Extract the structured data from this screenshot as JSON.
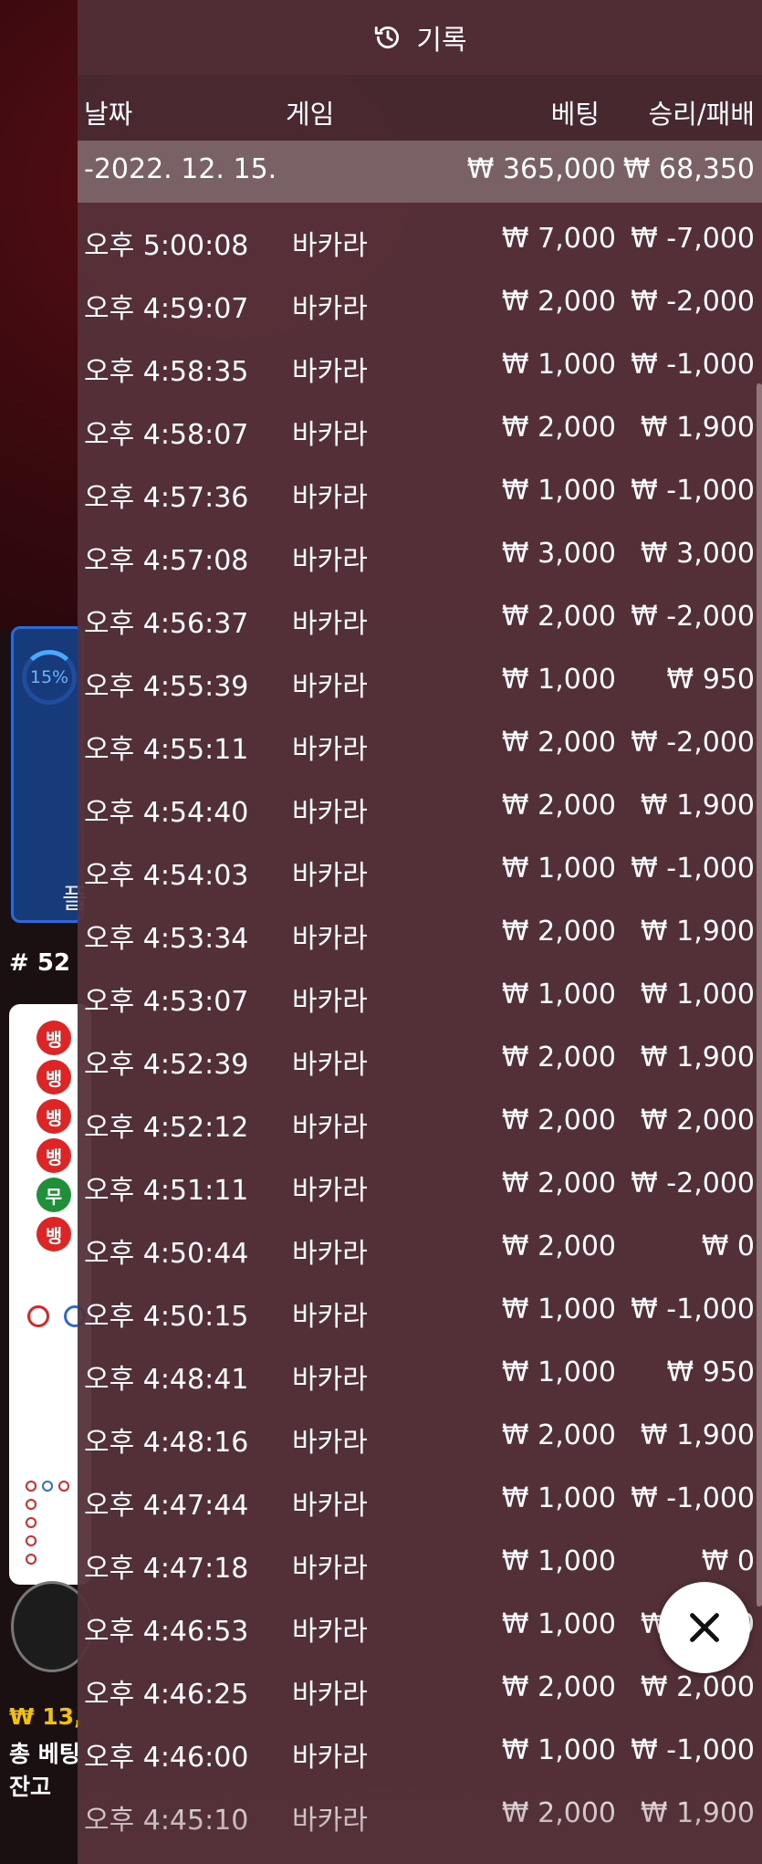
{
  "header": {
    "title": "기록"
  },
  "columns": {
    "date": "날짜",
    "game": "게임",
    "bet": "베팅",
    "result": "승리/패배"
  },
  "date_group": {
    "date": "-2022. 12. 15.",
    "total_bet": "₩ 365,000",
    "total_result": "₩ 68,350"
  },
  "rows": [
    {
      "time": "오후 5:00:08",
      "game": "바카라",
      "bet": "₩ 7,000",
      "result": "₩ -7,000"
    },
    {
      "time": "오후 4:59:07",
      "game": "바카라",
      "bet": "₩ 2,000",
      "result": "₩ -2,000"
    },
    {
      "time": "오후 4:58:35",
      "game": "바카라",
      "bet": "₩ 1,000",
      "result": "₩ -1,000"
    },
    {
      "time": "오후 4:58:07",
      "game": "바카라",
      "bet": "₩ 2,000",
      "result": "₩ 1,900"
    },
    {
      "time": "오후 4:57:36",
      "game": "바카라",
      "bet": "₩ 1,000",
      "result": "₩ -1,000"
    },
    {
      "time": "오후 4:57:08",
      "game": "바카라",
      "bet": "₩ 3,000",
      "result": "₩ 3,000"
    },
    {
      "time": "오후 4:56:37",
      "game": "바카라",
      "bet": "₩ 2,000",
      "result": "₩ -2,000"
    },
    {
      "time": "오후 4:55:39",
      "game": "바카라",
      "bet": "₩ 1,000",
      "result": "₩ 950"
    },
    {
      "time": "오후 4:55:11",
      "game": "바카라",
      "bet": "₩ 2,000",
      "result": "₩ -2,000"
    },
    {
      "time": "오후 4:54:40",
      "game": "바카라",
      "bet": "₩ 2,000",
      "result": "₩ 1,900"
    },
    {
      "time": "오후 4:54:03",
      "game": "바카라",
      "bet": "₩ 1,000",
      "result": "₩ -1,000"
    },
    {
      "time": "오후 4:53:34",
      "game": "바카라",
      "bet": "₩ 2,000",
      "result": "₩ 1,900"
    },
    {
      "time": "오후 4:53:07",
      "game": "바카라",
      "bet": "₩ 1,000",
      "result": "₩ 1,000"
    },
    {
      "time": "오후 4:52:39",
      "game": "바카라",
      "bet": "₩ 2,000",
      "result": "₩ 1,900"
    },
    {
      "time": "오후 4:52:12",
      "game": "바카라",
      "bet": "₩ 2,000",
      "result": "₩ 2,000"
    },
    {
      "time": "오후 4:51:11",
      "game": "바카라",
      "bet": "₩ 2,000",
      "result": "₩ -2,000"
    },
    {
      "time": "오후 4:50:44",
      "game": "바카라",
      "bet": "₩ 2,000",
      "result": "₩ 0"
    },
    {
      "time": "오후 4:50:15",
      "game": "바카라",
      "bet": "₩ 1,000",
      "result": "₩ -1,000"
    },
    {
      "time": "오후 4:48:41",
      "game": "바카라",
      "bet": "₩ 1,000",
      "result": "₩ 950"
    },
    {
      "time": "오후 4:48:16",
      "game": "바카라",
      "bet": "₩ 2,000",
      "result": "₩ 1,900"
    },
    {
      "time": "오후 4:47:44",
      "game": "바카라",
      "bet": "₩ 1,000",
      "result": "₩ -1,000"
    },
    {
      "time": "오후 4:47:18",
      "game": "바카라",
      "bet": "₩ 1,000",
      "result": "₩ 0"
    },
    {
      "time": "오후 4:46:53",
      "game": "바카라",
      "bet": "₩ 1,000",
      "result": "₩ 1,000"
    },
    {
      "time": "오후 4:46:25",
      "game": "바카라",
      "bet": "₩ 2,000",
      "result": "₩ 2,000"
    },
    {
      "time": "오후 4:46:00",
      "game": "바카라",
      "bet": "₩ 1,000",
      "result": "₩ -1,000"
    },
    {
      "time": "오후 4:45:10",
      "game": "바카라",
      "bet": "₩ 2,000",
      "result": "₩ 1,900"
    }
  ],
  "background": {
    "promo_percent": "15%",
    "round_label": "# 52",
    "road_chips": [
      "뱅",
      "뱅",
      "뱅",
      "뱅",
      "무",
      "뱅"
    ],
    "balance_amount": "₩ 13,",
    "total_bet_label": "총 베팅",
    "balance_label": "잔고"
  },
  "colors": {
    "panel": "#56323a",
    "date_row": "#7a6166",
    "banker": "#e02424",
    "tie": "#1f8f3a",
    "promo": "#173a7a",
    "gold": "#f2c400"
  },
  "icons": {
    "header": "history-icon",
    "close": "close-icon"
  }
}
